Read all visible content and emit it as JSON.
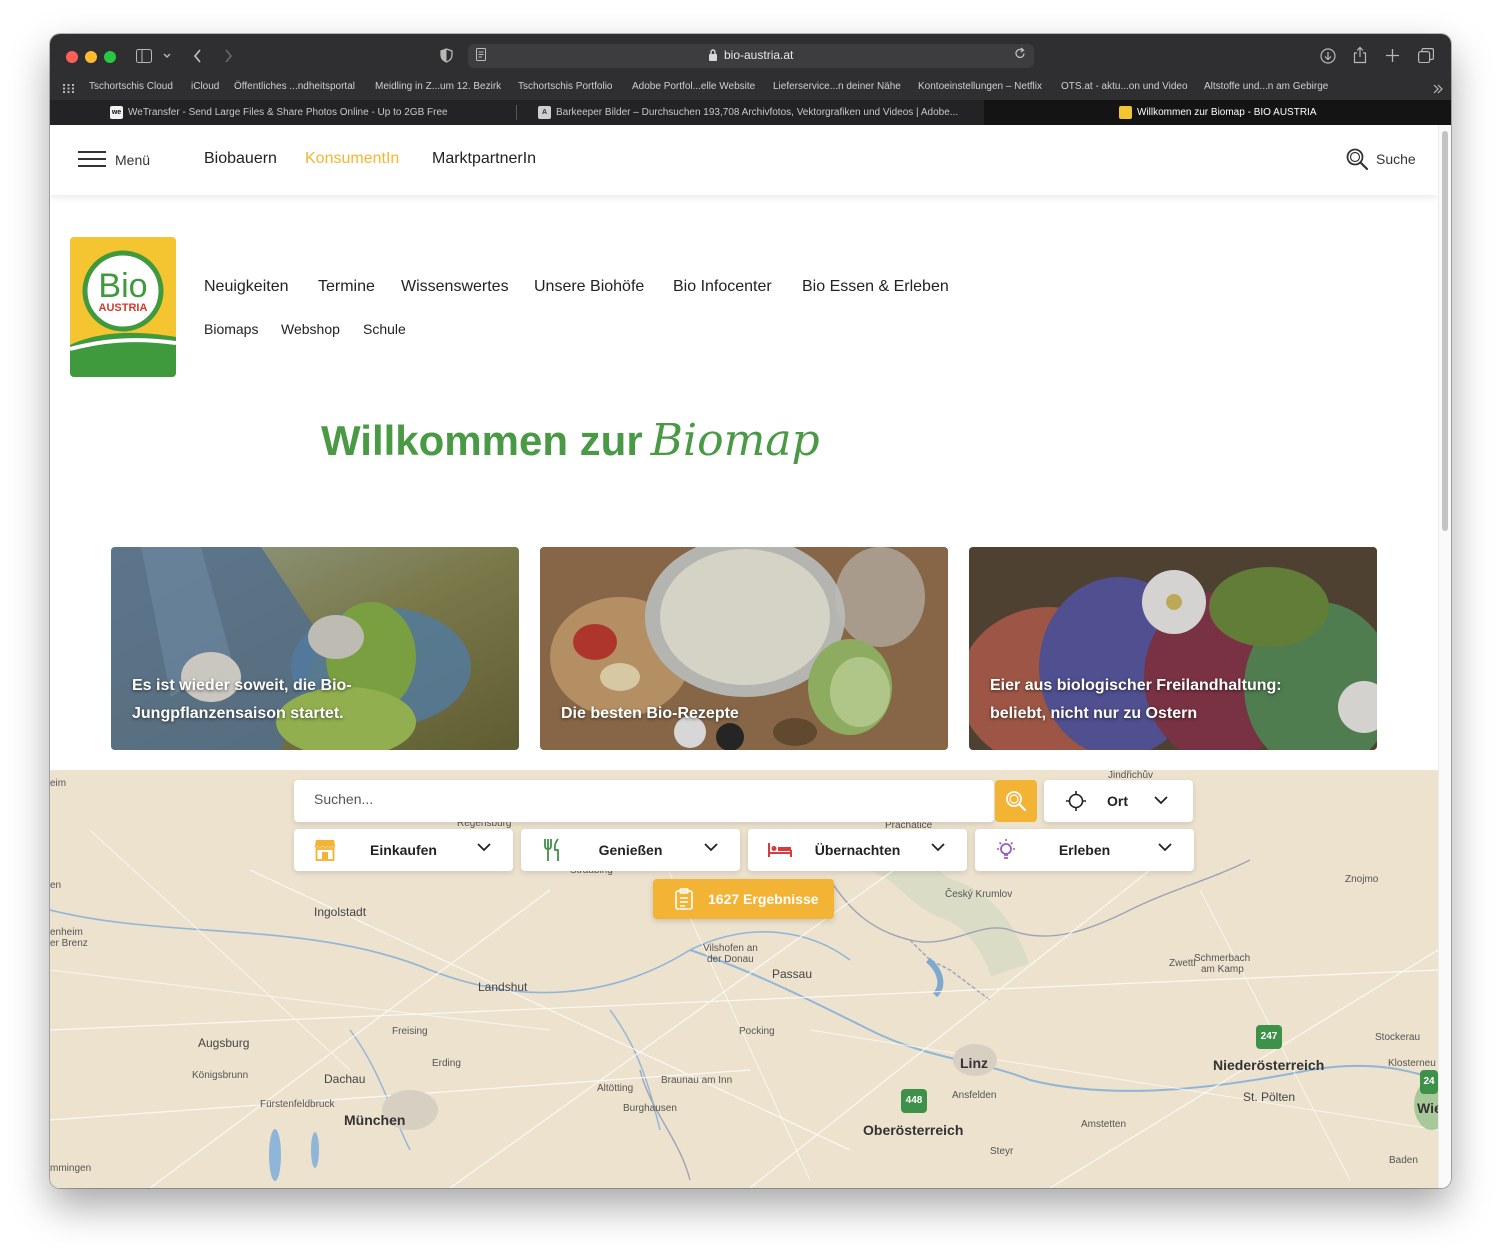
{
  "browser": {
    "url": "bio-austria.at",
    "bookmarks": [
      "Tschortschis Cloud",
      "iCloud",
      "Öffentliches ...ndheitsportal",
      "Meidling in Z...um 12. Bezirk",
      "Tschortschis Portfolio",
      "Adobe Portfol...elle Website",
      "Lieferservice...n deiner Nähe",
      "Kontoeinstellungen – Netflix",
      "OTS.at - aktu...on und Video",
      "Altstoffe und...n am Gebirge"
    ],
    "tabs": [
      {
        "favicon": "we",
        "title": "WeTransfer - Send Large Files & Share Photos Online - Up to 2GB Free"
      },
      {
        "favicon": "A",
        "title": "Barkeeper Bilder – Durchsuchen 193,708 Archivfotos, Vektorgrafiken und Videos | Adobe..."
      },
      {
        "favicon": "",
        "title": "Willkommen zur Biomap - BIO AUSTRIA"
      }
    ]
  },
  "header": {
    "menu_label": "Menü",
    "nav": [
      "Biobauern",
      "KonsumentIn",
      "MarktpartnerIn"
    ],
    "active": "KonsumentIn",
    "search_label": "Suche"
  },
  "logo": {
    "line1": "Bio",
    "line2": "AUSTRIA"
  },
  "main_nav": [
    "Neuigkeiten",
    "Termine",
    "Wissenswertes",
    "Unsere Biohöfe",
    "Bio Infocenter",
    "Bio Essen & Erleben"
  ],
  "sub_nav": [
    "Biomaps",
    "Webshop",
    "Schule"
  ],
  "welcome": {
    "text": "Willkommen zur",
    "script": "Biomap"
  },
  "cards": [
    {
      "caption_l1": "Es ist wieder soweit, die Bio-",
      "caption_l2": "Jungpflanzensaison startet."
    },
    {
      "caption_l1": "",
      "caption_l2": "Die besten Bio-Rezepte"
    },
    {
      "caption_l1": "Eier aus biologischer Freilandhaltung:",
      "caption_l2": "beliebt, nicht nur zu Ostern"
    }
  ],
  "map": {
    "search_placeholder": "Suchen...",
    "location_label": "Ort",
    "filters": [
      "Einkaufen",
      "Genießen",
      "Übernachten",
      "Erleben"
    ],
    "results_label": "1627 Ergebnisse",
    "places": [
      {
        "name": "Jindřichův",
        "class": ""
      },
      {
        "name": "Regensburg",
        "class": ""
      },
      {
        "name": "Prachatice",
        "class": ""
      },
      {
        "name": "Straubing",
        "class": ""
      },
      {
        "name": "Znojmo",
        "class": ""
      },
      {
        "name": "Ingolstadt",
        "class": "med"
      },
      {
        "name": "Český Krumlov",
        "class": ""
      },
      {
        "name": "Vilshofen an",
        "class": ""
      },
      {
        "name": "der Donau",
        "class": ""
      },
      {
        "name": "Passau",
        "class": "med"
      },
      {
        "name": "Zwettl",
        "class": ""
      },
      {
        "name": "Schmerbach",
        "class": ""
      },
      {
        "name": "am Kamp",
        "class": ""
      },
      {
        "name": "Landshut",
        "class": "med"
      },
      {
        "name": "Freising",
        "class": ""
      },
      {
        "name": "Pocking",
        "class": ""
      },
      {
        "name": "Augsburg",
        "class": "med"
      },
      {
        "name": "Erding",
        "class": ""
      },
      {
        "name": "Linz",
        "class": "big"
      },
      {
        "name": "Niederösterreich",
        "class": "big"
      },
      {
        "name": "Stockerau",
        "class": ""
      },
      {
        "name": "Klosterneu",
        "class": ""
      },
      {
        "name": "Königsbrunn",
        "class": ""
      },
      {
        "name": "Dachau",
        "class": ""
      },
      {
        "name": "Altötting",
        "class": ""
      },
      {
        "name": "Braunau am Inn",
        "class": ""
      },
      {
        "name": "Ansfelden",
        "class": ""
      },
      {
        "name": "Fürstenfeldbruck",
        "class": ""
      },
      {
        "name": "Burghausen",
        "class": ""
      },
      {
        "name": "St. Pölten",
        "class": "med"
      },
      {
        "name": "Wie",
        "class": "big"
      },
      {
        "name": "München",
        "class": "big"
      },
      {
        "name": "Oberösterreich",
        "class": "big"
      },
      {
        "name": "Amstetten",
        "class": ""
      },
      {
        "name": "Steyr",
        "class": ""
      },
      {
        "name": "Baden",
        "class": ""
      },
      {
        "name": "mmingen",
        "class": ""
      },
      {
        "name": "eim",
        "class": ""
      },
      {
        "name": "en",
        "class": ""
      },
      {
        "name": "enheim",
        "class": ""
      },
      {
        "name": "er Brenz",
        "class": ""
      }
    ],
    "markers": [
      "247",
      "448",
      "24"
    ]
  }
}
